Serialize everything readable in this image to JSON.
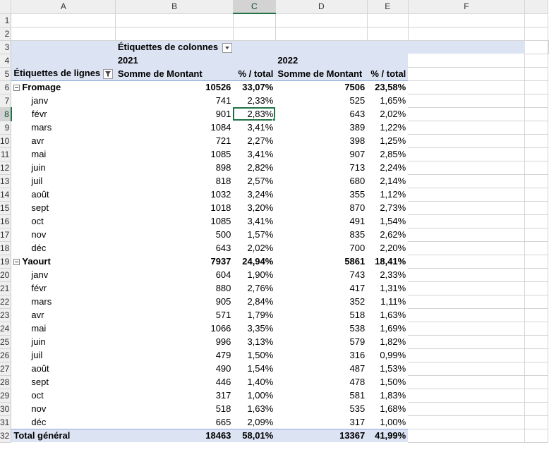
{
  "columns": [
    "A",
    "B",
    "C",
    "D",
    "E",
    "F"
  ],
  "selected_column": "C",
  "selected_row": 8,
  "row_numbers": [
    "1",
    "2",
    "3",
    "4",
    "5",
    "6",
    "7",
    "8",
    "9",
    "10",
    "11",
    "12",
    "13",
    "14",
    "15",
    "16",
    "17",
    "18",
    "19",
    "20",
    "21",
    "22",
    "23",
    "24",
    "25",
    "26",
    "27",
    "28",
    "29",
    "30",
    "31",
    "32"
  ],
  "pivot": {
    "col_labels_caption": "Étiquettes de colonnes",
    "row_labels_caption": "Étiquettes de lignes",
    "year_2021": "2021",
    "year_2022": "2022",
    "sum_label": "Somme de Montant",
    "pct_label": "% / total",
    "groups": [
      {
        "name": "Fromage",
        "v2021": "10526",
        "p2021": "33,07%",
        "v2022": "7506",
        "p2022": "23,58%",
        "months": [
          {
            "m": "janv",
            "v21": "741",
            "p21": "2,33%",
            "v22": "525",
            "p22": "1,65%"
          },
          {
            "m": "févr",
            "v21": "901",
            "p21": "2,83%",
            "v22": "643",
            "p22": "2,02%"
          },
          {
            "m": "mars",
            "v21": "1084",
            "p21": "3,41%",
            "v22": "389",
            "p22": "1,22%"
          },
          {
            "m": "avr",
            "v21": "721",
            "p21": "2,27%",
            "v22": "398",
            "p22": "1,25%"
          },
          {
            "m": "mai",
            "v21": "1085",
            "p21": "3,41%",
            "v22": "907",
            "p22": "2,85%"
          },
          {
            "m": "juin",
            "v21": "898",
            "p21": "2,82%",
            "v22": "713",
            "p22": "2,24%"
          },
          {
            "m": "juil",
            "v21": "818",
            "p21": "2,57%",
            "v22": "680",
            "p22": "2,14%"
          },
          {
            "m": "août",
            "v21": "1032",
            "p21": "3,24%",
            "v22": "355",
            "p22": "1,12%"
          },
          {
            "m": "sept",
            "v21": "1018",
            "p21": "3,20%",
            "v22": "870",
            "p22": "2,73%"
          },
          {
            "m": "oct",
            "v21": "1085",
            "p21": "3,41%",
            "v22": "491",
            "p22": "1,54%"
          },
          {
            "m": "nov",
            "v21": "500",
            "p21": "1,57%",
            "v22": "835",
            "p22": "2,62%"
          },
          {
            "m": "déc",
            "v21": "643",
            "p21": "2,02%",
            "v22": "700",
            "p22": "2,20%"
          }
        ]
      },
      {
        "name": "Yaourt",
        "v2021": "7937",
        "p2021": "24,94%",
        "v2022": "5861",
        "p2022": "18,41%",
        "months": [
          {
            "m": "janv",
            "v21": "604",
            "p21": "1,90%",
            "v22": "743",
            "p22": "2,33%"
          },
          {
            "m": "févr",
            "v21": "880",
            "p21": "2,76%",
            "v22": "417",
            "p22": "1,31%"
          },
          {
            "m": "mars",
            "v21": "905",
            "p21": "2,84%",
            "v22": "352",
            "p22": "1,11%"
          },
          {
            "m": "avr",
            "v21": "571",
            "p21": "1,79%",
            "v22": "518",
            "p22": "1,63%"
          },
          {
            "m": "mai",
            "v21": "1066",
            "p21": "3,35%",
            "v22": "538",
            "p22": "1,69%"
          },
          {
            "m": "juin",
            "v21": "996",
            "p21": "3,13%",
            "v22": "579",
            "p22": "1,82%"
          },
          {
            "m": "juil",
            "v21": "479",
            "p21": "1,50%",
            "v22": "316",
            "p22": "0,99%"
          },
          {
            "m": "août",
            "v21": "490",
            "p21": "1,54%",
            "v22": "487",
            "p22": "1,53%"
          },
          {
            "m": "sept",
            "v21": "446",
            "p21": "1,40%",
            "v22": "478",
            "p22": "1,50%"
          },
          {
            "m": "oct",
            "v21": "317",
            "p21": "1,00%",
            "v22": "581",
            "p22": "1,83%"
          },
          {
            "m": "nov",
            "v21": "518",
            "p21": "1,63%",
            "v22": "535",
            "p22": "1,68%"
          },
          {
            "m": "déc",
            "v21": "665",
            "p21": "2,09%",
            "v22": "317",
            "p22": "1,00%"
          }
        ]
      }
    ],
    "total": {
      "label": "Total général",
      "v2021": "18463",
      "p2021": "58,01%",
      "v2022": "13367",
      "p2022": "41,99%"
    }
  },
  "colors": {
    "pivot_band": "#dce3f2",
    "accent": "#217346"
  },
  "icons": {
    "filter": "filter-dropdown-icon",
    "collapse": "collapse-minus-icon"
  }
}
